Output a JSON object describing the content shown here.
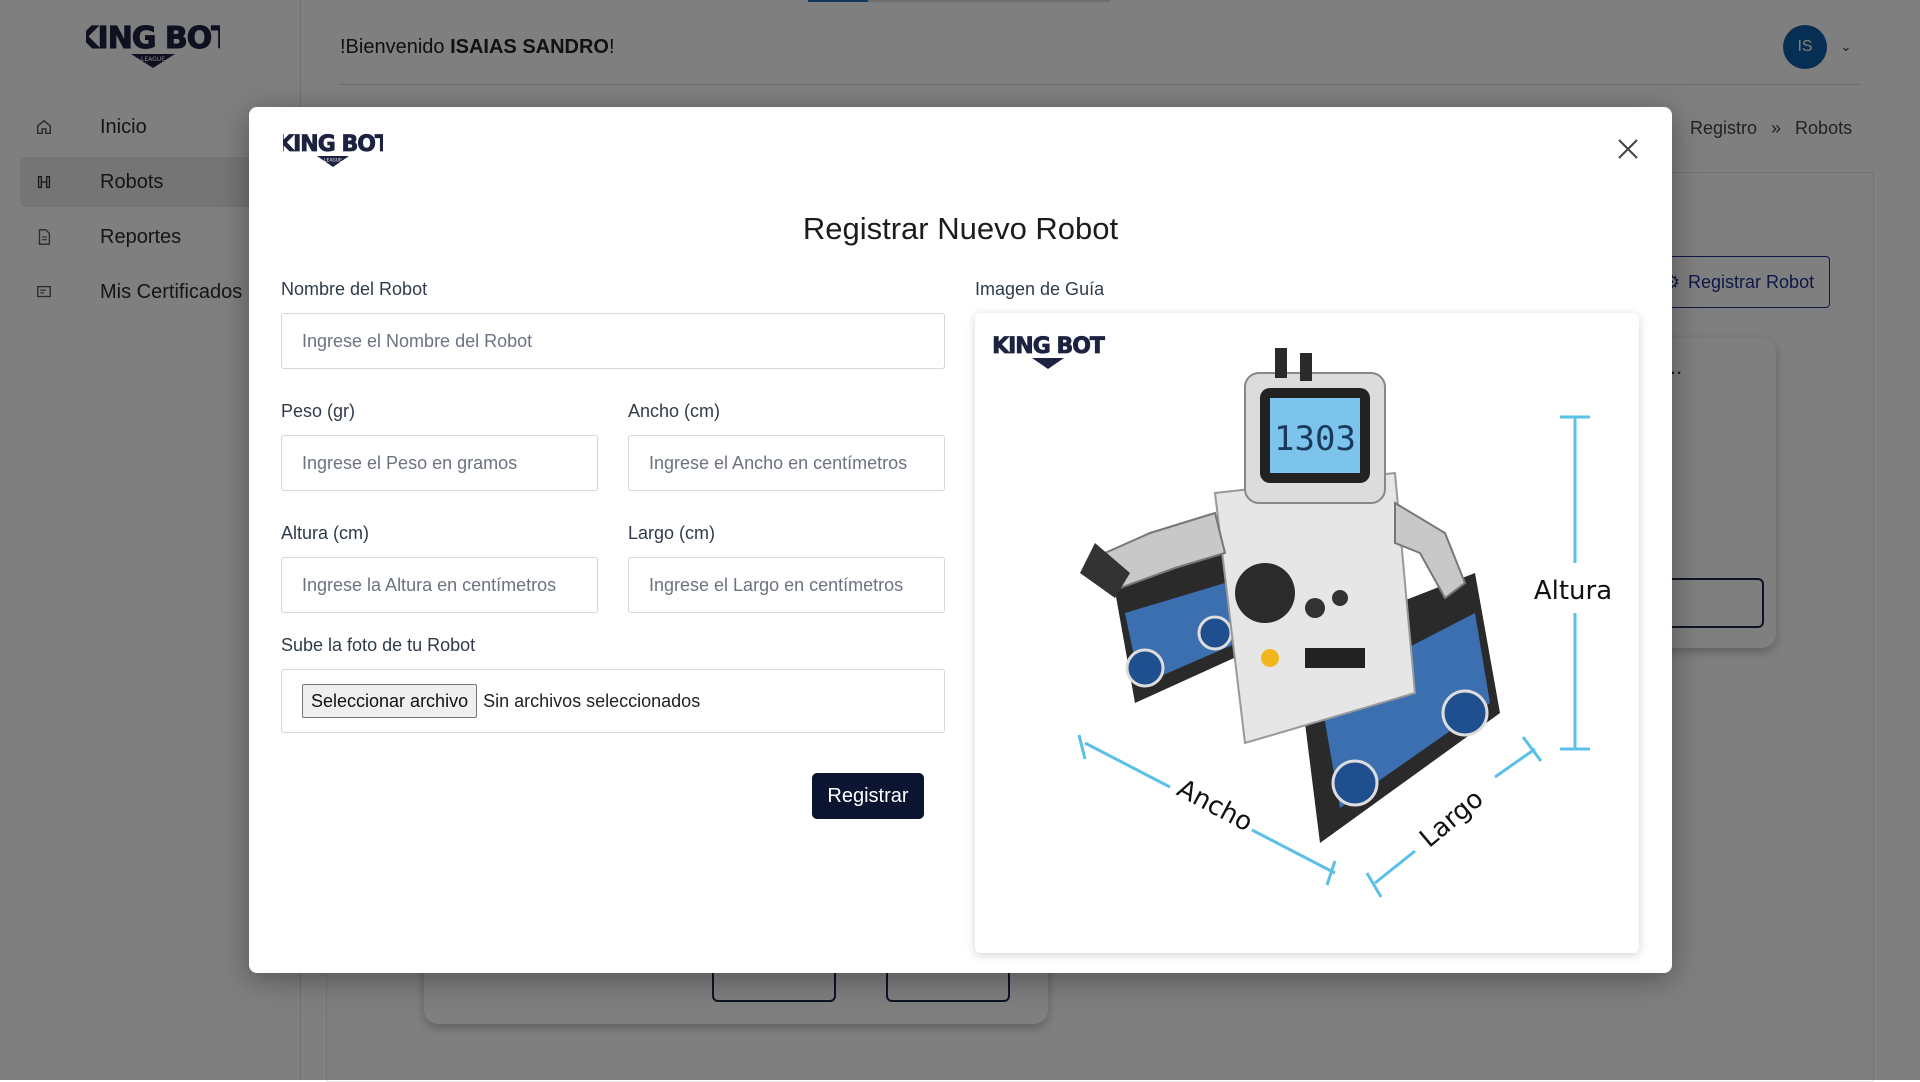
{
  "brand": {
    "logo_text": "KING BOT",
    "logo_sub": "LEAGUE"
  },
  "sidebar": {
    "items": [
      {
        "label": "Inicio",
        "icon": "home-icon"
      },
      {
        "label": "Robots",
        "icon": "robot-icon"
      },
      {
        "label": "Reportes",
        "icon": "document-icon"
      },
      {
        "label": "Mis Certificados",
        "icon": "certificate-icon"
      }
    ]
  },
  "header": {
    "welcome_prefix": "!Bienvenido ",
    "user_name": "ISAIAS SANDRO",
    "welcome_suffix": "!",
    "avatar_initials": "IS"
  },
  "breadcrumb": {
    "items": [
      "Registro",
      "Robots"
    ]
  },
  "page": {
    "register_button": "Registrar Robot",
    "card_dots": ".."
  },
  "modal": {
    "title": "Registrar Nuevo Robot",
    "fields": {
      "name": {
        "label": "Nombre del Robot",
        "placeholder": "Ingrese el Nombre del Robot",
        "value": ""
      },
      "weight": {
        "label": "Peso (gr)",
        "placeholder": "Ingrese el Peso en gramos",
        "value": ""
      },
      "width": {
        "label": "Ancho (cm)",
        "placeholder": "Ingrese el Ancho en centímetros",
        "value": ""
      },
      "height": {
        "label": "Altura (cm)",
        "placeholder": "Ingrese la Altura en centímetros",
        "value": ""
      },
      "length": {
        "label": "Largo (cm)",
        "placeholder": "Ingrese el Largo en centímetros",
        "value": ""
      }
    },
    "photo": {
      "label": "Sube la foto de tu Robot",
      "button": "Seleccionar archivo",
      "status": "Sin archivos seleccionados"
    },
    "submit_label": "Registrar",
    "guide": {
      "label": "Imagen de Guía",
      "dimension_labels": {
        "height": "Altura",
        "width": "Ancho",
        "length": "Largo"
      },
      "display_digits": "1303"
    }
  },
  "colors": {
    "primary_dark": "#0b1430",
    "avatar": "#0f5ea8",
    "guide_lines": "#5bc0e8",
    "brand_navy": "#1f2f8a"
  }
}
